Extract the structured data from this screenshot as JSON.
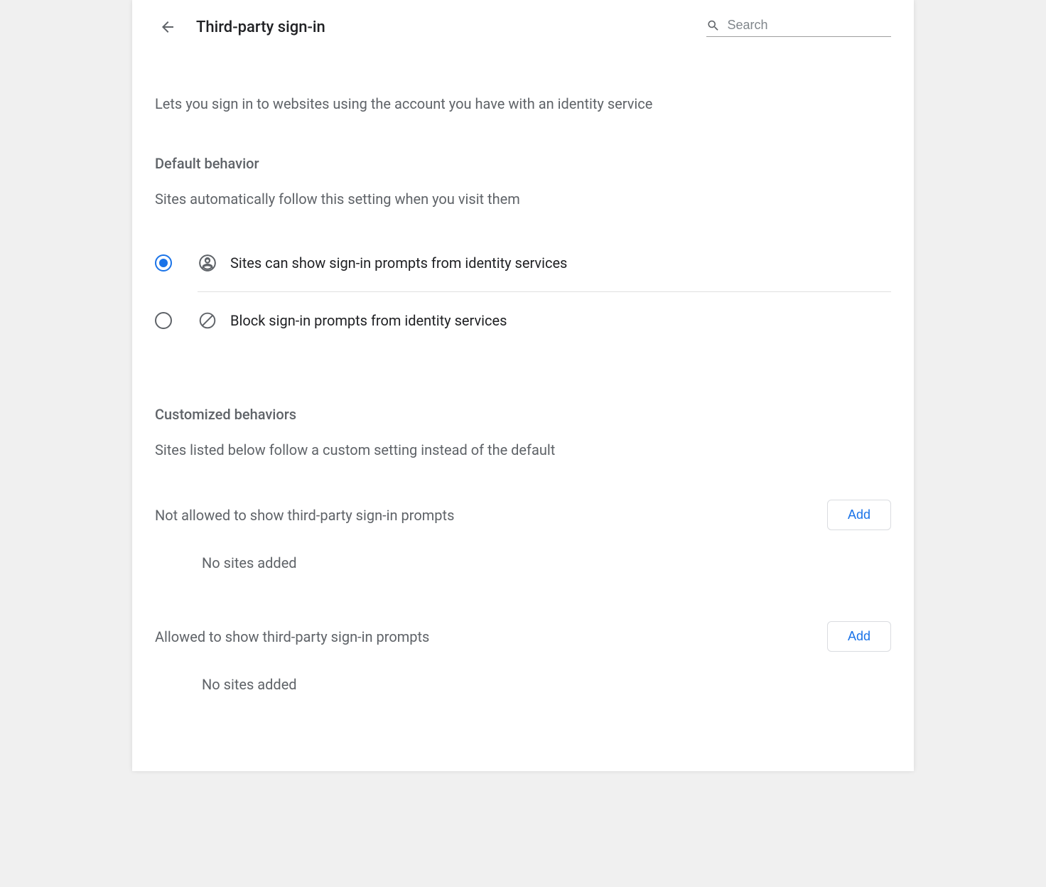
{
  "header": {
    "title": "Third-party sign-in",
    "search_placeholder": "Search"
  },
  "description": "Lets you sign in to websites using the account you have with an identity service",
  "default_behavior": {
    "title": "Default behavior",
    "subtitle": "Sites automatically follow this setting when you visit them",
    "options": [
      {
        "label": "Sites can show sign-in prompts from identity services",
        "selected": true
      },
      {
        "label": "Block sign-in prompts from identity services",
        "selected": false
      }
    ]
  },
  "customized_behaviors": {
    "title": "Customized behaviors",
    "subtitle": "Sites listed below follow a custom setting instead of the default",
    "sections": [
      {
        "label": "Not allowed to show third-party sign-in prompts",
        "button": "Add",
        "empty": "No sites added"
      },
      {
        "label": "Allowed to show third-party sign-in prompts",
        "button": "Add",
        "empty": "No sites added"
      }
    ]
  }
}
